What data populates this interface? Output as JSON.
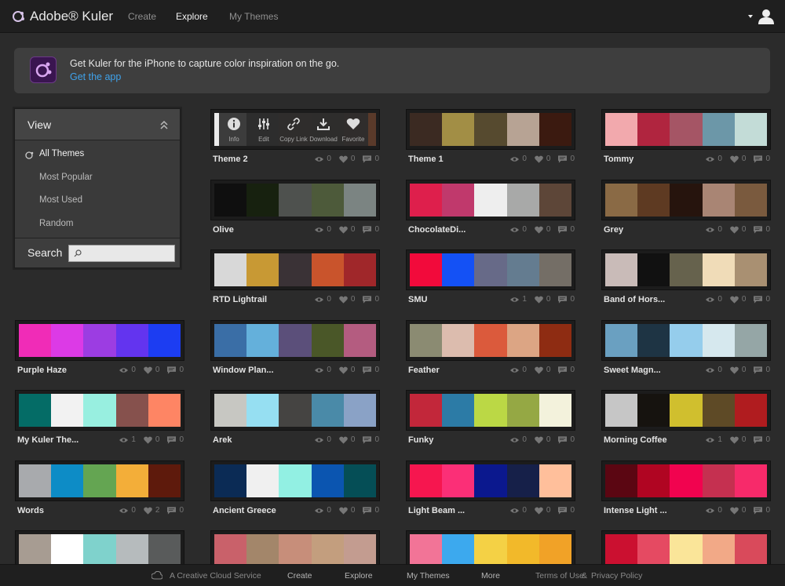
{
  "nav": {
    "brand": "Adobe® Kuler",
    "links": [
      {
        "label": "Create",
        "active": false
      },
      {
        "label": "Explore",
        "active": true
      },
      {
        "label": "My Themes",
        "active": false
      }
    ]
  },
  "banner": {
    "text": "Get Kuler for the iPhone to capture color inspiration on the go.",
    "link": "Get the app"
  },
  "sidebar": {
    "title": "View",
    "items": [
      {
        "label": "All Themes",
        "active": true
      },
      {
        "label": "Most Popular",
        "active": false
      },
      {
        "label": "Most Used",
        "active": false
      },
      {
        "label": "Random",
        "active": false
      }
    ],
    "search_label": "Search",
    "search_value": ""
  },
  "hover_actions": [
    "Info",
    "Edit",
    "Copy Link",
    "Download",
    "Favorite"
  ],
  "themes": [
    {
      "name": "Theme 2",
      "views": "0",
      "likes": "0",
      "comments": "0",
      "colors": [
        "#e9e9e9",
        "#3b3b3b",
        "#4a3c2c",
        "#3f3426",
        "#5a3a2a"
      ]
    },
    {
      "name": "Theme 1",
      "views": "0",
      "likes": "0",
      "comments": "0",
      "colors": [
        "#3b2a22",
        "#a28e45",
        "#564a2f",
        "#b7a394",
        "#3b1a10"
      ]
    },
    {
      "name": "Tommy",
      "views": "0",
      "likes": "0",
      "comments": "0",
      "colors": [
        "#f2a9ad",
        "#b0253f",
        "#a55565",
        "#6c97a8",
        "#c3dcd7"
      ]
    },
    {
      "name": "Olive",
      "views": "0",
      "likes": "0",
      "comments": "0",
      "colors": [
        "#0f0f0f",
        "#17210f",
        "#4e514e",
        "#4d5a3a",
        "#7b8482"
      ]
    },
    {
      "name": "ChocolateDi...",
      "views": "0",
      "likes": "0",
      "comments": "0",
      "colors": [
        "#de1f4c",
        "#c0396c",
        "#eeeeee",
        "#a8a9a8",
        "#5d4638"
      ]
    },
    {
      "name": "Grey",
      "views": "0",
      "likes": "0",
      "comments": "0",
      "colors": [
        "#8a6a45",
        "#5e3a22",
        "#26140d",
        "#a98574",
        "#7a5a3e"
      ]
    },
    {
      "name": "RTD Lightrail",
      "views": "0",
      "likes": "0",
      "comments": "0",
      "colors": [
        "#d8d8d8",
        "#c89934",
        "#3a3236",
        "#c9542c",
        "#a0272a"
      ]
    },
    {
      "name": "SMU",
      "views": "1",
      "likes": "0",
      "comments": "0",
      "colors": [
        "#f20a3b",
        "#1451f5",
        "#676a88",
        "#647c90",
        "#746e66"
      ]
    },
    {
      "name": "Band of Hors...",
      "views": "0",
      "likes": "0",
      "comments": "0",
      "colors": [
        "#c9bbb8",
        "#111111",
        "#66624d",
        "#f0dcb8",
        "#a99072"
      ]
    },
    {
      "name": "Purple Haze",
      "views": "0",
      "likes": "0",
      "comments": "0",
      "colors": [
        "#f02cb7",
        "#dc3ae6",
        "#9c3de2",
        "#6334ef",
        "#1c3df2"
      ]
    },
    {
      "name": "Window Plan...",
      "views": "0",
      "likes": "0",
      "comments": "0",
      "colors": [
        "#3a6ea6",
        "#64b0db",
        "#5b4f7a",
        "#4a5728",
        "#b45c80"
      ]
    },
    {
      "name": "Feather",
      "views": "0",
      "likes": "0",
      "comments": "0",
      "colors": [
        "#8b8b72",
        "#dcbcae",
        "#db5a3c",
        "#dca584",
        "#8e2c12"
      ]
    },
    {
      "name": "Sweet Magn...",
      "views": "0",
      "likes": "0",
      "comments": "0",
      "colors": [
        "#6aa0c1",
        "#1e3444",
        "#95cdec",
        "#d6e8ee",
        "#95a6a6"
      ]
    },
    {
      "name": "My Kuler The...",
      "views": "1",
      "likes": "0",
      "comments": "0",
      "colors": [
        "#046c66",
        "#f2f2f2",
        "#98efe0",
        "#86514d",
        "#fe8564"
      ]
    },
    {
      "name": "Arek",
      "views": "0",
      "likes": "0",
      "comments": "0",
      "colors": [
        "#c7c7c2",
        "#96dff2",
        "#454442",
        "#4a8aa8",
        "#8aa2c6"
      ]
    },
    {
      "name": "Funky",
      "views": "0",
      "likes": "0",
      "comments": "0",
      "colors": [
        "#c2273a",
        "#2c7ba6",
        "#bbd845",
        "#95a844",
        "#f3f2dc"
      ]
    },
    {
      "name": "Morning Coffee",
      "views": "1",
      "likes": "0",
      "comments": "0",
      "colors": [
        "#c6c6c6",
        "#16130f",
        "#d0bf2e",
        "#5e4a26",
        "#b01c1f"
      ]
    },
    {
      "name": "Words",
      "views": "0",
      "likes": "2",
      "comments": "0",
      "colors": [
        "#a8aaad",
        "#0d8cc6",
        "#64a552",
        "#f3ae39",
        "#5e1a0c"
      ]
    },
    {
      "name": "Ancient Greece",
      "views": "0",
      "likes": "0",
      "comments": "0",
      "colors": [
        "#0b2b55",
        "#f0f0f0",
        "#92f0e3",
        "#0b55b0",
        "#054e56"
      ]
    },
    {
      "name": "Light Beam ...",
      "views": "0",
      "likes": "0",
      "comments": "0",
      "colors": [
        "#f6164f",
        "#fb2f77",
        "#0b188e",
        "#162049",
        "#ffbf9b"
      ]
    },
    {
      "name": "Intense Light ...",
      "views": "0",
      "likes": "0",
      "comments": "0",
      "colors": [
        "#5b0612",
        "#b00522",
        "#f1034f",
        "#c53050",
        "#f72a6a"
      ]
    },
    {
      "name": "",
      "views": "",
      "likes": "",
      "comments": "",
      "colors": [
        "#a79c92",
        "#ffffff",
        "#7fd2cc",
        "#b6bbbd",
        "#595b5b"
      ]
    },
    {
      "name": "",
      "views": "",
      "likes": "",
      "comments": "",
      "colors": [
        "#c9616a",
        "#a3866a",
        "#c78e7a",
        "#c39e7e",
        "#c39c90"
      ]
    },
    {
      "name": "",
      "views": "",
      "likes": "",
      "comments": "",
      "colors": [
        "#f27497",
        "#3ca9ee",
        "#f4d145",
        "#f2b92a",
        "#f1a227"
      ]
    },
    {
      "name": "",
      "views": "",
      "likes": "",
      "comments": "",
      "colors": [
        "#cb1030",
        "#e54a62",
        "#fae599",
        "#f2a987",
        "#d94a5b"
      ]
    }
  ],
  "footer": {
    "service": "A Creative Cloud Service",
    "links": [
      "Create",
      "Explore",
      "My Themes",
      "More"
    ],
    "terms": "Terms of Use",
    "amp": "&",
    "privacy": "Privacy Policy"
  }
}
